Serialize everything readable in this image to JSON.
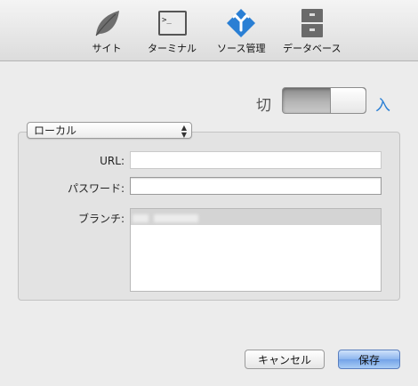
{
  "toolbar": {
    "items": [
      {
        "label": "サイト",
        "icon": "leaf-icon"
      },
      {
        "label": "ターミナル",
        "icon": "terminal-icon"
      },
      {
        "label": "ソース管理",
        "icon": "source-control-icon"
      },
      {
        "label": "データベース",
        "icon": "database-icon"
      }
    ]
  },
  "toggle": {
    "off_label": "切",
    "on_label": "入",
    "state": "off"
  },
  "source": {
    "selected": "ローカル"
  },
  "form": {
    "url_label": "URL:",
    "url_value": "",
    "password_label": "パスワード:",
    "password_value": "",
    "branch_label": "ブランチ:"
  },
  "buttons": {
    "cancel": "キャンセル",
    "save": "保存"
  },
  "colors": {
    "accent": "#2a7fd4",
    "source_control_icon": "#2a7fd4",
    "default_button": "#8db6ee"
  }
}
